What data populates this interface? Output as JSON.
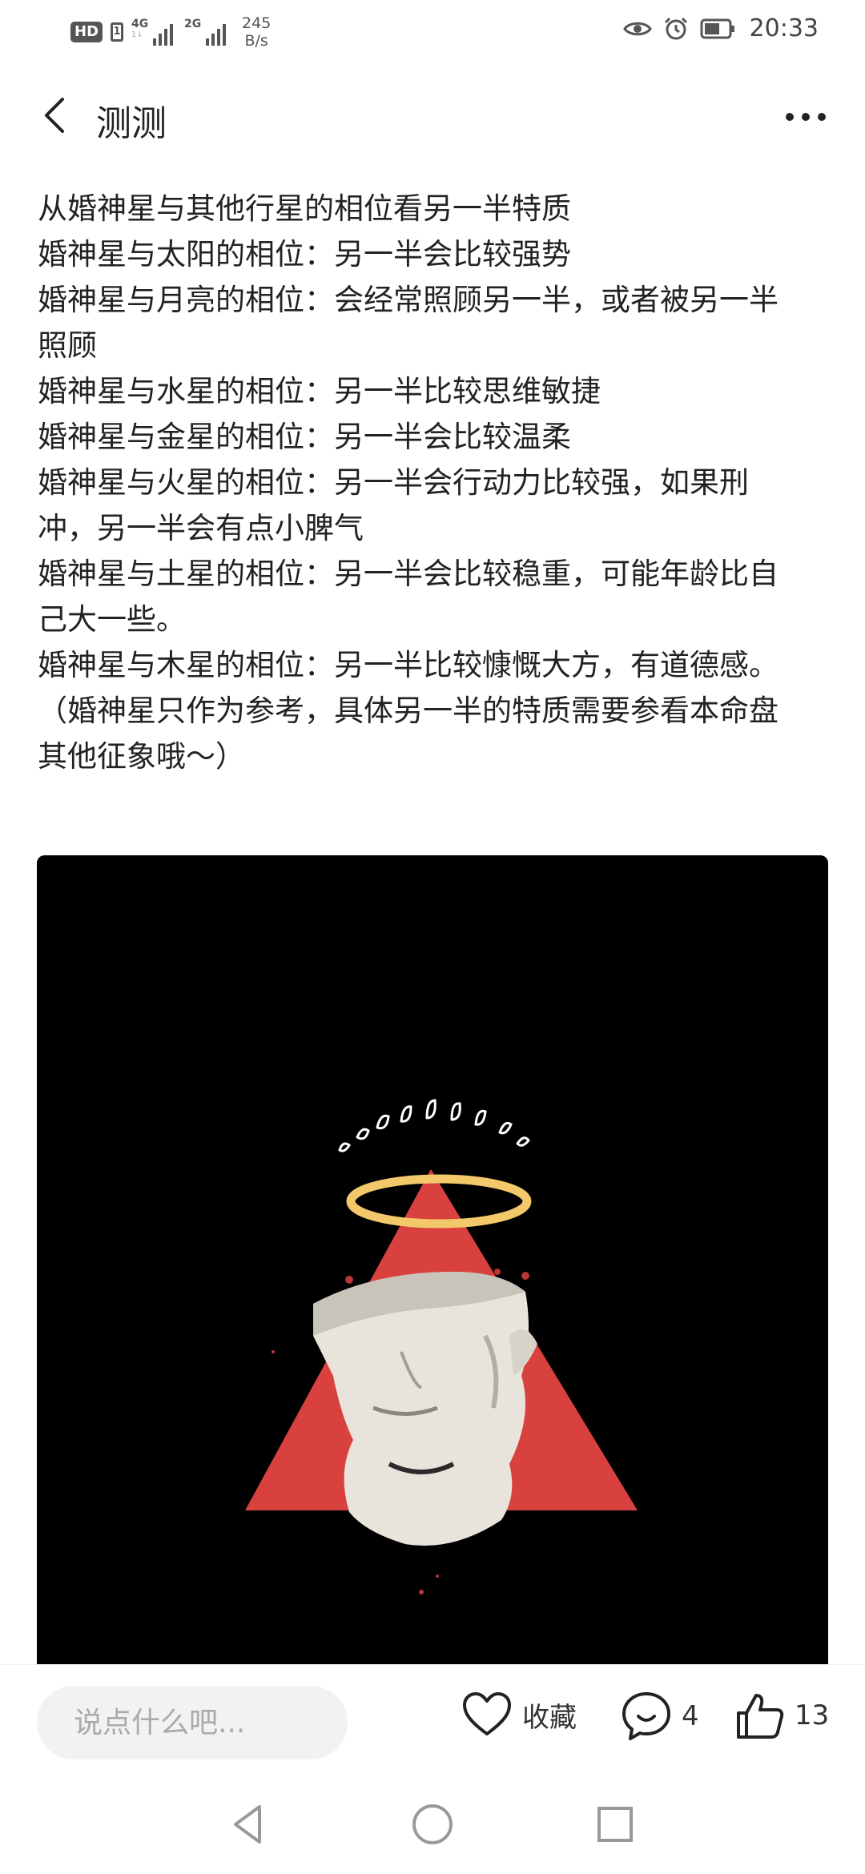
{
  "status_bar": {
    "hd": "HD",
    "sim": "1",
    "net1_label": "4G",
    "net2_label": "2G",
    "speed_value": "245",
    "speed_unit": "B/s",
    "time": "20:33",
    "icons": [
      "eye-icon",
      "alarm-icon",
      "battery-icon"
    ]
  },
  "app_bar": {
    "title": "测测"
  },
  "article": {
    "lines": [
      "从婚神星与其他行星的相位看另一半特质",
      "婚神星与太阳的相位：另一半会比较强势",
      "婚神星与月亮的相位：会经常照顾另一半，或者被另一半照顾",
      "婚神星与水星的相位：另一半比较思维敏捷",
      "婚神星与金星的相位：另一半会比较温柔",
      "婚神星与火星的相位：另一半会行动力比较强，如果刑冲，另一半会有点小脾气",
      "婚神星与土星的相位：另一半会比较稳重，可能年龄比自己大一些。",
      "婚神星与木星的相位：另一半比较慷慨大方，有道德感。",
      "（婚神星只作为参考，具体另一半的特质需要参看本命盘其他征象哦～）"
    ]
  },
  "image": {
    "colors": {
      "background": "#000000",
      "triangle": "#d9413f",
      "halo": "#f3c86a",
      "bust": "#e8e4dc"
    }
  },
  "bottom_bar": {
    "comment_placeholder": "说点什么吧...",
    "favorite_label": "收藏",
    "comment_count": "4",
    "like_count": "13"
  },
  "system_nav": {
    "icons": [
      "back-triangle-icon",
      "home-circle-icon",
      "recents-square-icon"
    ]
  }
}
